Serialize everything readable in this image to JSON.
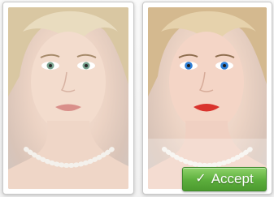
{
  "comparison": {
    "before_photo": {
      "label": ""
    },
    "after_photo": {
      "label": ""
    }
  },
  "actions": {
    "accept_label": "Accept",
    "accept_icon": "checkmark-icon",
    "accept_color": "#5cae3c"
  },
  "colors": {
    "eyes_before": "#7aa38f",
    "eyes_after": "#2f7fd6",
    "lips_before": "#d98f8a",
    "lips_after": "#d9332d"
  }
}
